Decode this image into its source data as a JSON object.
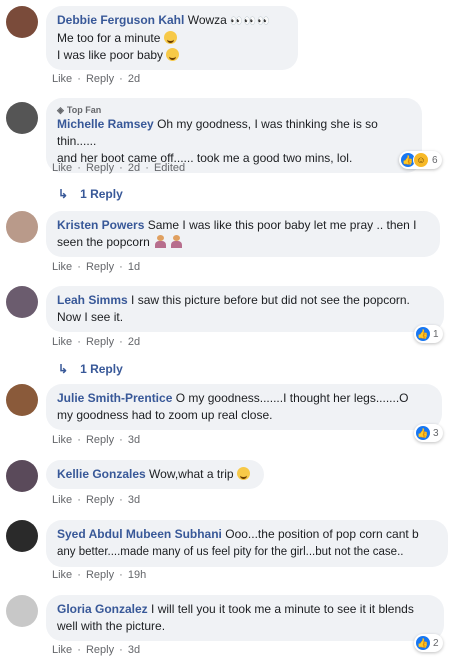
{
  "comments": [
    {
      "name": "Debbie Ferguson Kahl",
      "line1": "Wowza",
      "line2": "Me too for a minute",
      "line3": "I was like poor baby",
      "like": "Like",
      "reply": "Reply",
      "time": "2d",
      "avatar_color": "#7a4b3a"
    },
    {
      "badge": "Top Fan",
      "name": "Michelle Ramsey",
      "line1": "Oh my goodness, I was thinking she is so thin......",
      "line2": "and her boot came off...... took me a good two mins, lol.",
      "like": "Like",
      "reply": "Reply",
      "time": "2d",
      "edited": "Edited",
      "reactions_count": "6",
      "replies": "1 Reply",
      "avatar_color": "#555555"
    },
    {
      "name": "Kristen Powers",
      "line1": "Same I was like this poor baby let me pray .. then I",
      "line2": "seen the popcorn",
      "like": "Like",
      "reply": "Reply",
      "time": "1d",
      "avatar_color": "#b99a8a"
    },
    {
      "name": "Leah Simms",
      "line1": "I saw this picture before but did not see the popcorn.",
      "line2": "Now I see it.",
      "like": "Like",
      "reply": "Reply",
      "time": "2d",
      "reactions_count": "1",
      "replies": "1 Reply",
      "avatar_color": "#6b5c6e"
    },
    {
      "name": "Julie Smith-Prentice",
      "line1": "O my goodness.......I thought her legs.......O",
      "line2": "my goodness had to zoom up real close.",
      "like": "Like",
      "reply": "Reply",
      "time": "3d",
      "reactions_count": "3",
      "avatar_color": "#8a5a3a"
    },
    {
      "name": "Kellie Gonzales",
      "line1": "Wow,what a trip",
      "like": "Like",
      "reply": "Reply",
      "time": "3d",
      "avatar_color": "#5a4a5a"
    },
    {
      "name": "Syed Abdul Mubeen Subhani",
      "line1": "Ooo...the position of pop corn cant b",
      "line2": "any better....made many of us feel pity for the girl...but not the case..",
      "like": "Like",
      "reply": "Reply",
      "time": "19h",
      "avatar_color": "#2a2a2a"
    },
    {
      "name": "Gloria Gonzalez",
      "line1": "I will tell you it took me a minute to see it it blends",
      "line2": "well with the picture.",
      "like": "Like",
      "reply": "Reply",
      "time": "3d",
      "reactions_count": "2",
      "avatar_color": "#c8c8c8"
    }
  ],
  "separator": "·",
  "colors": {
    "link": "#385898",
    "bubble": "#f0f2f5",
    "meta": "#65676b",
    "like_blue": "#1877f2"
  }
}
